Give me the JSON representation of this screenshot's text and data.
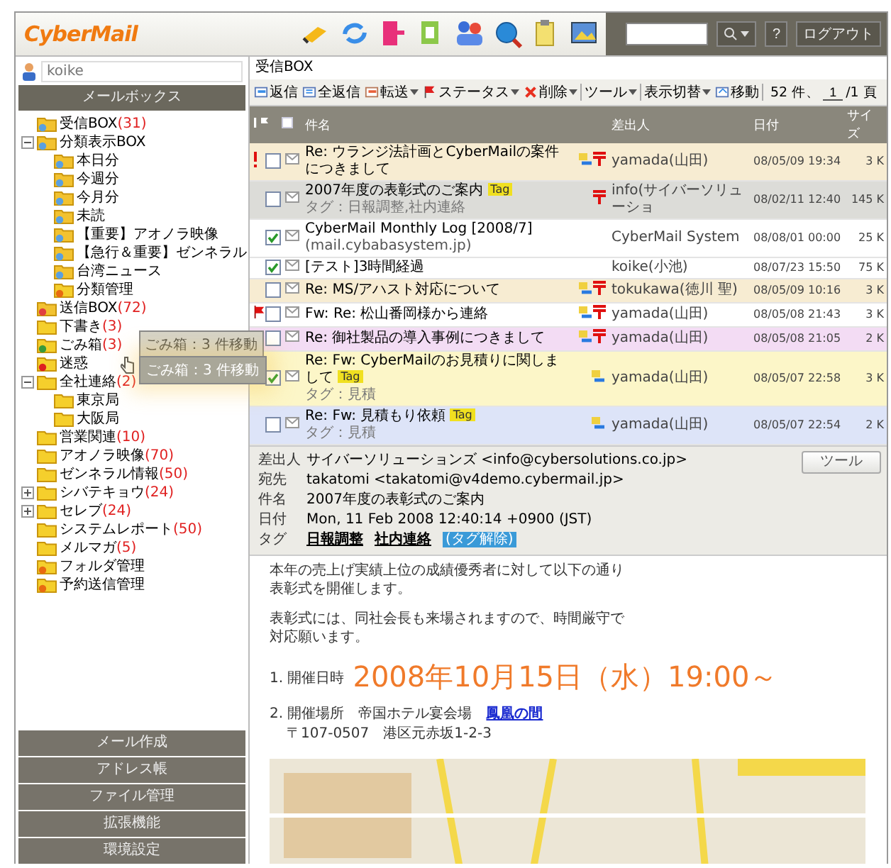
{
  "header": {
    "logo": "CyberMail",
    "help": "?",
    "logout": "ログアウト"
  },
  "sidebar": {
    "user": "koike",
    "section_title": "メールボックス",
    "folders": [
      {
        "kind": "inbox",
        "name": "受信BOX",
        "count": "(31)"
      },
      {
        "kind": "smart",
        "name": "分類表示BOX",
        "expanded": true,
        "children": [
          {
            "kind": "smart",
            "name": "本日分"
          },
          {
            "kind": "smart",
            "name": "今週分"
          },
          {
            "kind": "smart",
            "name": "今月分"
          },
          {
            "kind": "smart",
            "name": "未読"
          },
          {
            "kind": "smart",
            "name": "【重要】アオノラ映像"
          },
          {
            "kind": "smart",
            "name": "【急行＆重要】ゼンネラル"
          },
          {
            "kind": "smart",
            "name": "台湾ニュース"
          },
          {
            "kind": "manage",
            "name": "分類管理"
          }
        ]
      },
      {
        "kind": "sent",
        "name": "送信BOX",
        "count": "(72)"
      },
      {
        "kind": "folder",
        "name": "下書き",
        "count": "(3)"
      },
      {
        "kind": "trash",
        "name": "ごみ箱",
        "count": "(3)"
      },
      {
        "kind": "spam",
        "name": "迷惑"
      },
      {
        "kind": "folder",
        "name": "全社連絡",
        "count": "(2)",
        "expanded": true,
        "children": [
          {
            "kind": "folder",
            "name": "東京局"
          },
          {
            "kind": "folder",
            "name": "大阪局"
          }
        ]
      },
      {
        "kind": "folder",
        "name": "営業関連",
        "count": "(10)"
      },
      {
        "kind": "folder",
        "name": "アオノラ映像",
        "count": "(70)"
      },
      {
        "kind": "folder",
        "name": "ゼンネラル情報",
        "count": "(50)"
      },
      {
        "kind": "folder",
        "name": "シバテキョウ",
        "count": "(24)",
        "expanded": false
      },
      {
        "kind": "folder",
        "name": "セレブ",
        "count": "(24)",
        "expanded": false
      },
      {
        "kind": "folder",
        "name": "システムレポート",
        "count": "(50)"
      },
      {
        "kind": "folder",
        "name": "メルマガ",
        "count": "(5)"
      },
      {
        "kind": "manage",
        "name": "フォルダ管理"
      },
      {
        "kind": "manage",
        "name": "予約送信管理"
      }
    ],
    "nav": [
      "メール作成",
      "アドレス帳",
      "ファイル管理",
      "拡張機能",
      "環境設定"
    ]
  },
  "mailbox": {
    "title": "受信BOX",
    "toolbar": [
      {
        "kind": "reply",
        "label": "返信",
        "dropdown": false
      },
      {
        "kind": "reply_all",
        "label": "全返信",
        "dropdown": false
      },
      {
        "kind": "forward",
        "label": "転送",
        "dropdown": true
      },
      {
        "kind": "status",
        "label": "ステータス",
        "dropdown": true
      },
      {
        "kind": "delete",
        "label": "削除",
        "dropdown": true
      },
      {
        "kind": "plain",
        "label": "ツール",
        "dropdown": true
      },
      {
        "kind": "plain",
        "label": "表示切替",
        "dropdown": true
      },
      {
        "kind": "move",
        "label": "移動",
        "dropdown": false
      }
    ],
    "count": "52 件、",
    "page": "1",
    "pages": "/1 頁",
    "columns": [
      "件名",
      "差出人",
      "日付",
      "サイズ"
    ],
    "messages": [
      {
        "important": true,
        "flagged": false,
        "checked": false,
        "selected": false,
        "color": "#f7ecd2",
        "subject": "Re: ウランジ法計画とCyberMailの案件につきまして",
        "replied": true,
        "urgent": true,
        "sender": "yamada(山田)",
        "date": "08/05/09 19:34",
        "size": "3 K"
      },
      {
        "important": false,
        "flagged": false,
        "checked": false,
        "selected": true,
        "subject": "2007年度の表彰式のご案内",
        "badge": "Tag",
        "tags": "タグ：日報調整,社内連絡",
        "replied": false,
        "urgent": true,
        "sender": "info(サイバーソリューショ",
        "date": "08/02/11 12:40",
        "size": "145 K"
      },
      {
        "important": false,
        "flagged": false,
        "checked": true,
        "selected": false,
        "subject": "CyberMail Monthly Log [2008/7]",
        "subject2": "(mail.cybabasystem.jp)",
        "replied": false,
        "urgent": false,
        "sender": "CyberMail System",
        "date": "08/08/01 00:00",
        "size": "25 K"
      },
      {
        "important": false,
        "flagged": false,
        "checked": true,
        "selected": false,
        "subject": "[テスト]3時間経過",
        "replied": false,
        "urgent": false,
        "sender": "koike(小池)",
        "date": "08/07/23 15:50",
        "size": "75 K"
      },
      {
        "important": false,
        "flagged": false,
        "checked": false,
        "selected": false,
        "color": "#f7ecd2",
        "subject": "Re: MS/アハスト対応について",
        "replied": true,
        "urgent": true,
        "sender": "tokukawa(徳川 聖)",
        "date": "08/05/09 10:16",
        "size": "3 K"
      },
      {
        "important": false,
        "flagged": true,
        "checked": false,
        "selected": false,
        "subject": "Fw: Re: 松山番岡様から連絡",
        "replied": true,
        "urgent": true,
        "sender": "yamada(山田)",
        "date": "08/05/08 21:43",
        "size": "3 K"
      },
      {
        "important": false,
        "flagged": false,
        "checked": false,
        "selected": false,
        "color": "#f3dcf4",
        "subject": "Re: 御社製品の導入事例につきまして",
        "replied": true,
        "urgent": true,
        "sender": "yamada(山田)",
        "date": "08/05/08 21:05",
        "size": "2 K"
      },
      {
        "important": false,
        "flagged": false,
        "checked": true,
        "selected": false,
        "color": "#fcf6c8",
        "subject": "Re: Fw: CyberMailのお見積りに関しまして",
        "badge": "Tag",
        "tags": "タグ：見積",
        "replied": true,
        "urgent": false,
        "sender": "yamada(山田)",
        "date": "08/05/07 22:58",
        "size": "3 K"
      },
      {
        "important": false,
        "flagged": false,
        "checked": false,
        "selected": false,
        "color": "#dde4f8",
        "subject": "Re: Fw: 見積もり依頼",
        "badge": "Tag",
        "tags": "タグ：見積",
        "replied": true,
        "urgent": false,
        "sender": "yamada(山田)",
        "date": "08/05/07 22:54",
        "size": "2 K"
      }
    ]
  },
  "preview": {
    "tool_button": "ツール",
    "fields": [
      {
        "label": "差出人",
        "value": "サイバーソリューションズ <info@cybersolutions.co.jp>"
      },
      {
        "label": "宛先",
        "value": "takatomi <takatomi@v4demo.cybermail.jp>"
      },
      {
        "label": "件名",
        "value": "2007年度の表彰式のご案内"
      },
      {
        "label": "日付",
        "value": "Mon, 11 Feb 2008 12:40:14 +0900 (JST)"
      }
    ],
    "tag_label": "タグ",
    "tags": [
      "日報調整",
      "社内連絡"
    ],
    "untag": "(タグ解除)",
    "paragraphs": [
      [
        "本年の売上げ実績上位の成績優秀者に対して以下の通り",
        "表彰式を開催します。"
      ],
      [
        "表彰式には、同社会長も来場されますので、時間厳守で",
        "対応願います。"
      ]
    ],
    "item1_label": "1. 開催日時",
    "item1_value": "2008年10月15日（水）19:00～",
    "item2_label": "2. 開催場所　帝国ホテル宴会場",
    "item2_link": "鳳凰の間",
    "address": "〒107-0507　港区元赤坂1-2-3"
  },
  "drag_tooltips": [
    {
      "text": "ごみ箱：3 件移動",
      "faded": true
    },
    {
      "text": "ごみ箱：3 件移動",
      "faded": false
    }
  ]
}
